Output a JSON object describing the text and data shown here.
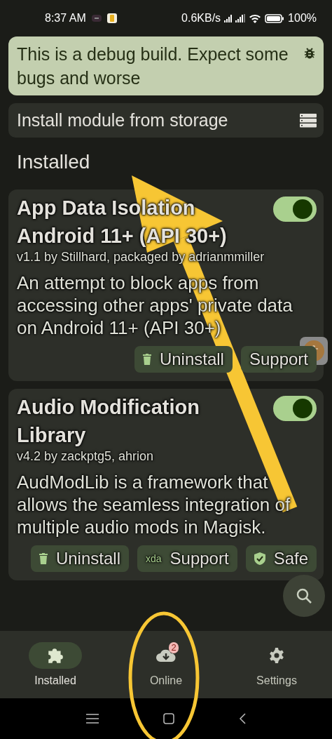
{
  "status_bar": {
    "time": "8:37 AM",
    "speed": "0.6KB/s",
    "battery": "100%"
  },
  "banner": {
    "text": "This is a debug build. Expect some bugs and worse"
  },
  "install_row": {
    "label": "Install module from storage"
  },
  "section_title": "Installed",
  "modules": [
    {
      "title": "App Data Isolation Android 11+ (API 30+)",
      "meta": "v1.1 by Stillhard, packaged by adrianmmiller",
      "description": "An attempt to block apps from accessing other apps' private data on Android 11+ (API 30+)",
      "enabled": true,
      "actions": [
        {
          "label": "Uninstall",
          "kind": "trash"
        },
        {
          "label": "Support",
          "kind": "plain"
        }
      ]
    },
    {
      "title": "Audio Modification Library",
      "meta": "v4.2 by zackptg5, ahrion",
      "description": "AudModLib is a framework that allows the seamless integration of multiple audio mods in Magisk.",
      "enabled": true,
      "actions": [
        {
          "label": "Uninstall",
          "kind": "trash"
        },
        {
          "label": "Support",
          "kind": "xda",
          "logo_text": "xda"
        },
        {
          "label": "Safe",
          "kind": "shield"
        }
      ]
    }
  ],
  "bottom_nav": [
    {
      "label": "Installed",
      "kind": "puzzle",
      "selected": true
    },
    {
      "label": "Online",
      "kind": "cloud",
      "selected": false,
      "badge": "2"
    },
    {
      "label": "Settings",
      "kind": "gear",
      "selected": false
    }
  ]
}
